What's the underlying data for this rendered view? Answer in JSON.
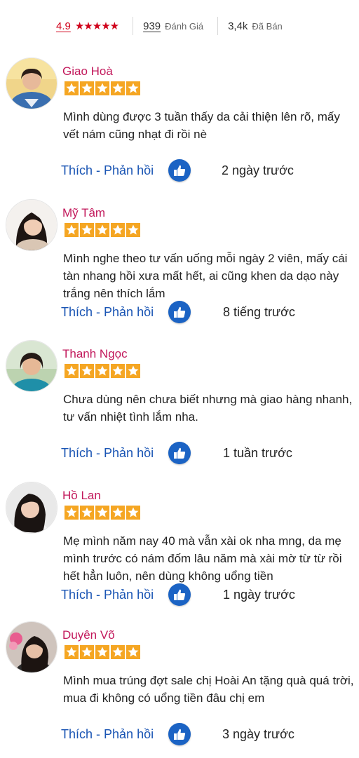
{
  "summary": {
    "rating": "4.9",
    "review_count": "939",
    "review_label": "Đánh Giá",
    "sold_count": "3,4k",
    "sold_label": "Đã Bán",
    "star_color": "#d0021b"
  },
  "actions": {
    "like_label": "Thích",
    "separator": " - ",
    "reply_label": "Phản hồi"
  },
  "colors": {
    "name": "#c2185b",
    "star": "#f5a623",
    "action_link": "#1a55b4",
    "like_button": "#1b63c4"
  },
  "reviews": [
    {
      "name": "Giao Hoà",
      "stars": 5,
      "comment": "Mình dùng được 3 tuần thấy da cải thiện lên rõ, mấy vết nám cũng nhạt đi rồi nè",
      "time": "2 ngày trước"
    },
    {
      "name": "Mỹ Tâm",
      "stars": 5,
      "comment": "Mình nghe theo tư vấn uống mỗi ngày 2 viên, mấy cái tàn nhang hồi xưa mất hết, ai cũng khen da dạo này trắng nên thích lắm",
      "time": "8 tiếng trước"
    },
    {
      "name": "Thanh Ngọc",
      "stars": 5,
      "comment": "Chưa dùng nên chưa biết nhưng mà giao hàng nhanh, tư vấn nhiệt tình lắm nha.",
      "time": "1 tuần trước"
    },
    {
      "name": "Hồ Lan",
      "stars": 5,
      "comment": "Mẹ mình năm nay 40 mà vẫn xài ok nha mng, da mẹ mình trước có nám đốm lâu năm mà xài mờ từ từ rồi hết hẳn luôn, nên dùng không uổng tiền",
      "time": "1 ngày trước"
    },
    {
      "name": "Duyên Võ",
      "stars": 5,
      "comment": "Mình mua trúng đợt sale chị Hoài An tặng quà quá trời, mua đi không có uổng tiền đâu chị em",
      "time": "3 ngày trước"
    }
  ]
}
